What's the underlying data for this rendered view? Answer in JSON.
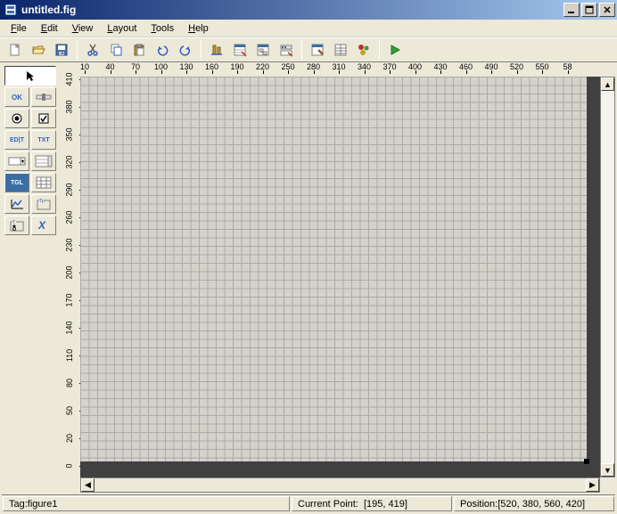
{
  "window": {
    "title": "untitled.fig"
  },
  "menu": {
    "file": "File",
    "edit": "Edit",
    "view": "View",
    "layout": "Layout",
    "tools": "Tools",
    "help": "Help"
  },
  "toolpanel": {
    "ok": "OK",
    "edit": "ED|T",
    "txt": "TXT",
    "tgl": "TGL"
  },
  "ruler": {
    "h": [
      "10",
      "40",
      "70",
      "100",
      "130",
      "160",
      "190",
      "220",
      "250",
      "280",
      "310",
      "340",
      "370",
      "400",
      "430",
      "460",
      "490",
      "520",
      "550",
      "58"
    ],
    "v": [
      "0",
      "20",
      "50",
      "80",
      "110",
      "140",
      "170",
      "200",
      "230",
      "260",
      "290",
      "320",
      "350",
      "380",
      "410"
    ]
  },
  "status": {
    "tag_label": "Tag: ",
    "tag_value": "figure1",
    "cp_label": "Current Point: ",
    "cp_value": "[195, 419]",
    "pos_label": "Position: ",
    "pos_value": "[520, 380, 560, 420]"
  }
}
